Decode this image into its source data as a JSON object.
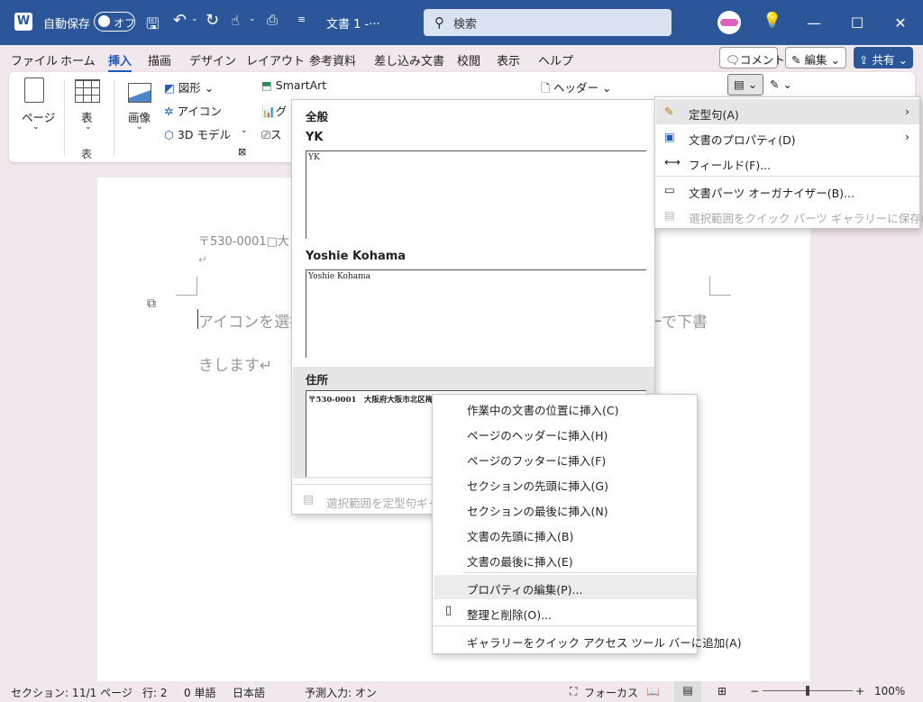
{
  "title_bar": {
    "app_icon": "W",
    "autosave_label": "自動保存",
    "autosave_toggle": "オフ",
    "doc_title": "文書 1  -···",
    "search_placeholder": "検索"
  },
  "menu": {
    "tabs": [
      "ファイル",
      "ホーム",
      "挿入",
      "描画",
      "デザイン",
      "レイアウト",
      "参考資料",
      "差し込み文書",
      "校閲",
      "表示",
      "ヘルプ"
    ],
    "active_tab": "挿入",
    "comment_label": "コメント",
    "edit_label": "編集",
    "share_label": "共有"
  },
  "ribbon": {
    "page": "ページ",
    "table": "表",
    "table_group": "表",
    "image": "画像",
    "shape": "図形",
    "icon": "アイコン",
    "model3d": "3D モデル",
    "smartart": "SmartArt",
    "chart_trunc": "グ",
    "screenshot_trunc": "ス",
    "header": "ヘッダー"
  },
  "document": {
    "address_line": "〒530-0001□大",
    "para_mark": "↵",
    "body_line1": "アイコンを選択",
    "body_line1_tail": "ーで下書",
    "body_line2": "きします↵"
  },
  "quickparts_gallery": {
    "section_general": "全般",
    "entries": [
      {
        "name": "YK",
        "preview": "YK"
      },
      {
        "name": "Yoshie Kohama",
        "preview": "Yoshie Kohama"
      },
      {
        "name": "住所",
        "preview": "〒530-0001　大阪府大阪市北区梅"
      }
    ],
    "footer_disabled": "選択範囲を定型句ギャラ"
  },
  "quickparts_menu": {
    "items": [
      {
        "label": "定型句(A)",
        "submenu": true,
        "enabled": true
      },
      {
        "label": "文書のプロパティ(D)",
        "submenu": true,
        "enabled": true
      },
      {
        "label": "フィールド(F)...",
        "submenu": false,
        "enabled": true
      },
      {
        "label": "文書パーツ オーガナイザー(B)...",
        "submenu": false,
        "enabled": true
      },
      {
        "label": "選択範囲をクイック パーツ ギャラリーに保存(S)...",
        "submenu": false,
        "enabled": false
      }
    ]
  },
  "context_menu": {
    "items": [
      "作業中の文書の位置に挿入(C)",
      "ページのヘッダーに挿入(H)",
      "ページのフッターに挿入(F)",
      "セクションの先頭に挿入(G)",
      "セクションの最後に挿入(N)",
      "文書の先頭に挿入(B)",
      "文書の最後に挿入(E)",
      "プロパティの編集(P)...",
      "整理と削除(O)...",
      "ギャラリーをクイック アクセス ツール バーに追加(A)"
    ]
  },
  "status_bar": {
    "section": "セクション: 1",
    "page": "1/1 ページ",
    "line": "行: 2",
    "words": "0 単語",
    "language": "日本語",
    "predictive": "予測入力: オン",
    "focus": "フォーカス",
    "zoom": "100%"
  },
  "colors": {
    "title_bg": "#2b579a",
    "app_bg": "#f1e8ee",
    "accent": "#1e5bbf"
  }
}
